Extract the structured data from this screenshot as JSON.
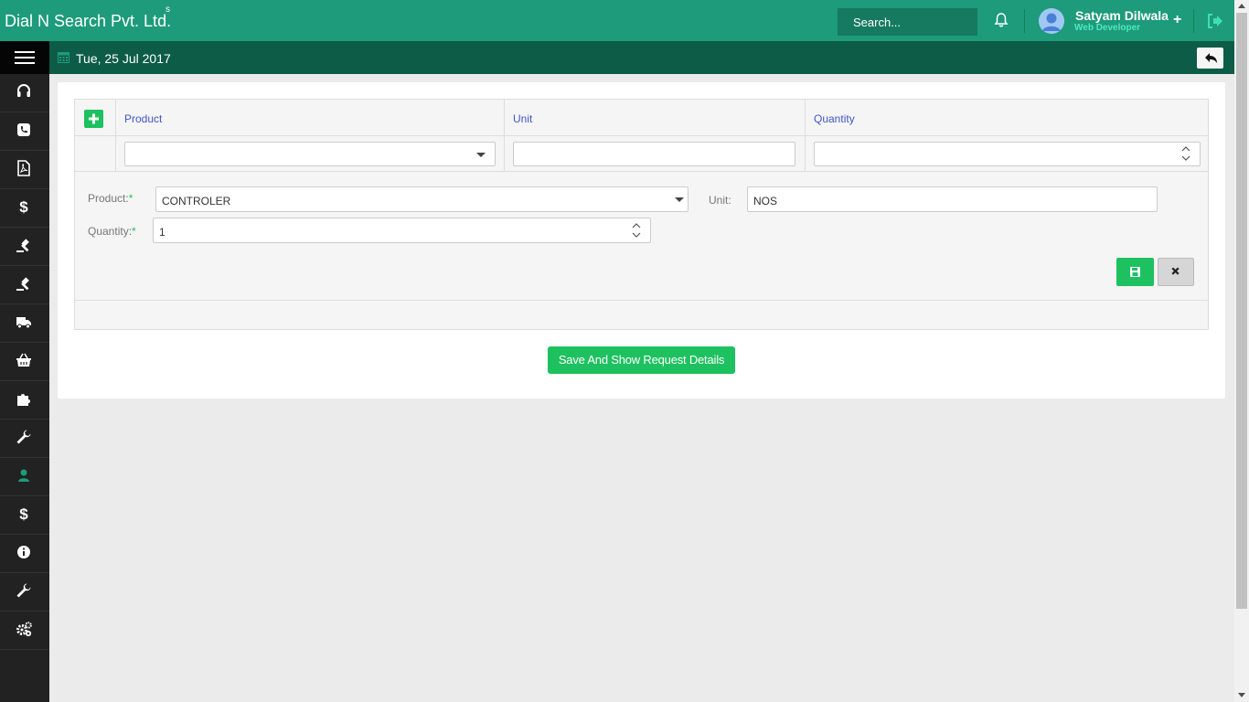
{
  "header": {
    "brand": "Dial N Search Pvt. Ltd.",
    "brand_sup": "s",
    "search_placeholder": "Search...",
    "user_name": "Satyam Dilwala",
    "user_role": "Web Developer",
    "plus_label": "+"
  },
  "subbar": {
    "date": "Tue, 25 Jul 2017"
  },
  "sidebar": {
    "items": [
      {
        "icon": "headset-icon"
      },
      {
        "icon": "phone-icon"
      },
      {
        "icon": "pdf-file-icon"
      },
      {
        "icon": "dollar-icon"
      },
      {
        "icon": "gavel-icon"
      },
      {
        "icon": "gavel-icon"
      },
      {
        "icon": "truck-icon"
      },
      {
        "icon": "basket-icon"
      },
      {
        "icon": "puzzle-icon"
      },
      {
        "icon": "wrench-icon"
      },
      {
        "icon": "user-icon",
        "active": true
      },
      {
        "icon": "dollar-icon"
      },
      {
        "icon": "info-icon"
      },
      {
        "icon": "wrench-icon"
      },
      {
        "icon": "cogs-icon"
      }
    ],
    "active_color": "#1d9b7a"
  },
  "grid": {
    "columns": [
      "Product",
      "Unit",
      "Quantity"
    ],
    "filter": {
      "product": "",
      "unit": "",
      "quantity": ""
    }
  },
  "form": {
    "product_label": "Product:",
    "product_value": "CONTROLER",
    "unit_label": "Unit:",
    "unit_value": "NOS",
    "quantity_label": "Quantity:",
    "quantity_value": "1",
    "required_mark": "*"
  },
  "actions": {
    "save_show_label": "Save And Show Request Details"
  },
  "colors": {
    "header": "#1d9b7a",
    "subbar": "#0d5c48",
    "accent_green": "#1ec15f",
    "column_header_text": "#4057c4"
  }
}
